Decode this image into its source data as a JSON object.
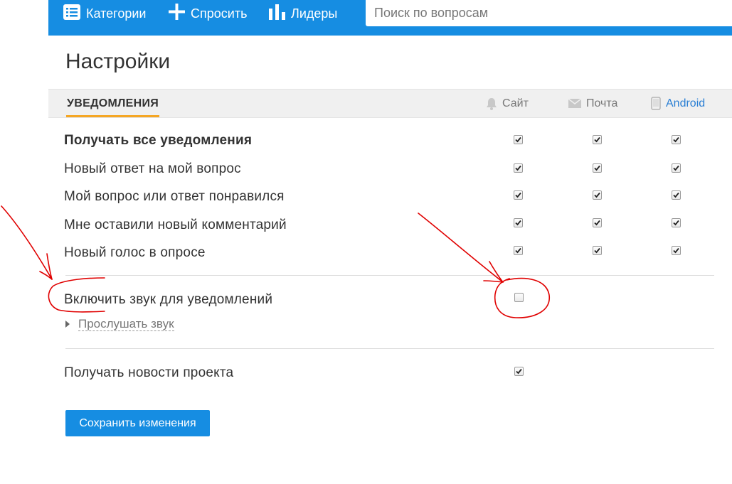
{
  "nav": {
    "categories": "Категории",
    "ask": "Спросить",
    "leaders": "Лидеры",
    "search_placeholder": "Поиск по вопросам"
  },
  "page_title": "Настройки",
  "tabs": {
    "active": "УВЕДОМЛЕНИЯ",
    "columns": {
      "site": "Сайт",
      "mail": "Почта",
      "android": "Android"
    }
  },
  "notifications": {
    "all": {
      "label": "Получать все уведомления",
      "site": true,
      "mail": true,
      "android": true
    },
    "new_answer": {
      "label": "Новый ответ на мой вопрос",
      "site": true,
      "mail": true,
      "android": true
    },
    "liked": {
      "label": "Мой вопрос или ответ понравился",
      "site": true,
      "mail": true,
      "android": true
    },
    "new_comment": {
      "label": "Мне оставили новый комментарий",
      "site": true,
      "mail": true,
      "android": true
    },
    "poll_vote": {
      "label": "Новый голос в опросе",
      "site": true,
      "mail": true,
      "android": true
    }
  },
  "sound": {
    "label": "Включить звук для уведомлений",
    "enabled": false,
    "listen_label": "Прослушать звук"
  },
  "news": {
    "label": "Получать новости проекта",
    "enabled": true
  },
  "save_label": "Сохранить изменения",
  "colors": {
    "brand": "#168de2",
    "tab_underline": "#f5a623",
    "annotation": "#e00000"
  }
}
